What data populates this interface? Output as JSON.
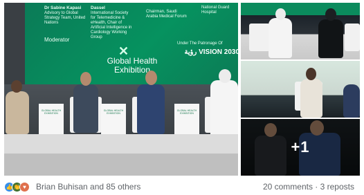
{
  "screen": {
    "col1_name": "Dr Sabine Kapasi",
    "col1_role": "Advisory to Global Strategy Team, United Nations",
    "col1_moderator": "Moderator",
    "col2_name": "Dassel",
    "col2_role": "International Society for Telemedicine & eHealth, Chair of Artificial Intelligence in Cardiology Working Group",
    "col3_role": "Chairman, Saudi Arabia Medical Forum",
    "col4_role": "National Guard Hospital",
    "event_name": "Global Health Exhibition",
    "patronage": "Under The Patronage Of",
    "vision": "VISION 2030",
    "vision_ar": "رؤية",
    "table_label": "GLOBAL HEALTH EXHIBITION"
  },
  "more_photos": "+1",
  "reactions": {
    "icons": [
      "like-icon",
      "celebrate-icon",
      "love-icon"
    ],
    "colors": [
      "#378fe9",
      "#44712e",
      "#df704d"
    ],
    "summary": "Brian Buhisan and 85 others"
  },
  "stats": "20 comments · 3 reposts"
}
